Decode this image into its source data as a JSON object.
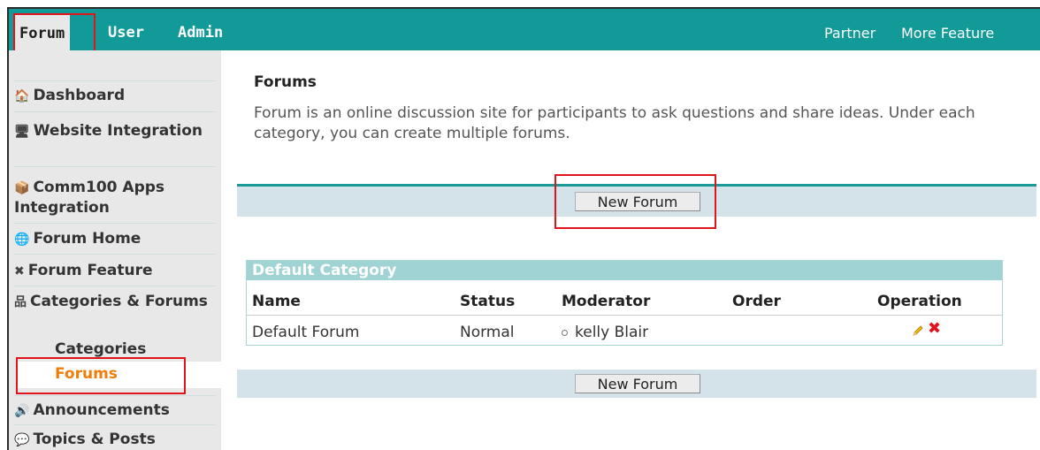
{
  "topnav": {
    "left_items": [
      "Forum",
      "User",
      "Admin"
    ],
    "active": "Forum",
    "right_items": [
      "Partner",
      "More Feature"
    ]
  },
  "sidebar": {
    "items": [
      {
        "icon": "home-icon",
        "glyph": "🏠",
        "label": "Dashboard"
      },
      {
        "icon": "website-icon",
        "glyph": "🖥",
        "label": "Website Integration"
      },
      {
        "icon": "apps-icon",
        "glyph": "📦",
        "label": "Comm100 Apps Integration"
      },
      {
        "icon": "globe-icon",
        "glyph": "🌐",
        "label": "Forum Home"
      },
      {
        "icon": "tools-icon",
        "glyph": "✖",
        "label": "Forum Feature"
      },
      {
        "icon": "hierarchy-icon",
        "glyph": "品",
        "label": "Categories & Forums"
      },
      {
        "icon": "speaker-icon",
        "glyph": "🔊",
        "label": "Announcements"
      },
      {
        "icon": "posts-icon",
        "glyph": "💬",
        "label": "Topics & Posts"
      }
    ],
    "sub_items": [
      "Categories",
      "Forums"
    ],
    "current_sub": "Forums"
  },
  "main": {
    "title": "Forums",
    "description": "Forum is an online discussion site for participants to ask questions and share ideas. Under each category, you can create multiple forums.",
    "new_forum_label": "New Forum"
  },
  "category": {
    "name": "Default Category",
    "columns": [
      "Name",
      "Status",
      "Moderator",
      "Order",
      "Operation"
    ],
    "rows": [
      {
        "name": "Default Forum",
        "status": "Normal",
        "moderator": "kelly Blair",
        "order": ""
      }
    ]
  },
  "colors": {
    "nav_teal": "#119a97",
    "highlight_red": "#e0141b",
    "current_orange": "#f07d0a",
    "category_header": "#9fd3d4"
  }
}
